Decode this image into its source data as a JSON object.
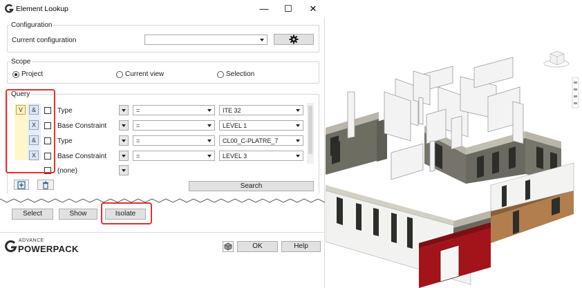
{
  "window": {
    "title": "Element Lookup"
  },
  "configuration": {
    "group_label": "Configuration",
    "current_label": "Current configuration",
    "current_value": ""
  },
  "scope": {
    "group_label": "Scope",
    "options": [
      "Project",
      "Current view",
      "Selection"
    ],
    "selected": "Project"
  },
  "query": {
    "group_label": "Query",
    "rows": [
      {
        "group_op": "V",
        "op": "&",
        "parameter": "Type",
        "condition": "=",
        "value": "ITE 32"
      },
      {
        "group_op": "",
        "op": "X",
        "parameter": "Base Constraint",
        "condition": "=",
        "value": "LEVEL 1"
      },
      {
        "group_op": "",
        "op": "&",
        "parameter": "Type",
        "condition": "=",
        "value": "CL00_C-PLATRE_7"
      },
      {
        "group_op": "",
        "op": "X",
        "parameter": "Base Constraint",
        "condition": "=",
        "value": "LEVEL 3"
      },
      {
        "group_op": "",
        "op": "",
        "parameter": "(none)",
        "condition": "",
        "value": ""
      }
    ],
    "search_label": "Search"
  },
  "actions": {
    "select_label": "Select",
    "show_label": "Show",
    "isolate_label": "Isolate"
  },
  "footer": {
    "brand_small": "ADVANCE",
    "brand_large": "POWERPACK",
    "ok_label": "OK",
    "help_label": "Help"
  },
  "colors": {
    "highlight": "#e0312f",
    "wall_red": "#a3141a",
    "wall_brown": "#b27e4e",
    "wall_grey": "#6e6d62"
  },
  "icons": [
    "app-g-icon",
    "minimize-icon",
    "maximize-icon",
    "close-icon",
    "gear-icon",
    "add-row-icon",
    "delete-icon",
    "cube-icon",
    "viewcube-icon"
  ]
}
